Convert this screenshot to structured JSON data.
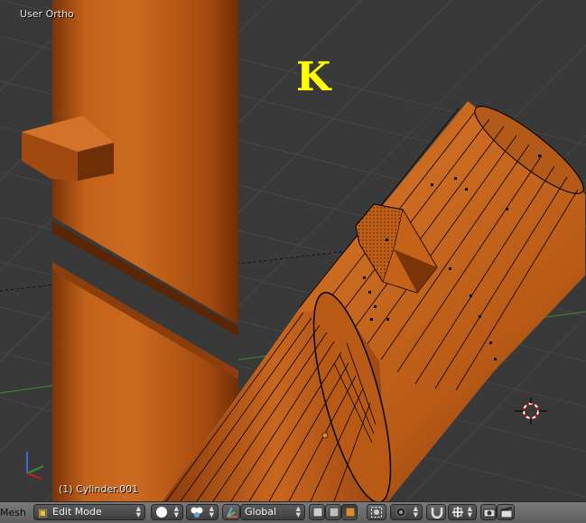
{
  "viewport": {
    "view_label": "User Ortho",
    "object_label": "(1) Cylinder.001",
    "key_indicator": "K",
    "icons": [
      "3d-cursor-icon",
      "axis-gizmo-icon"
    ]
  },
  "header": {
    "editor_type_label": "Mesh",
    "mode": {
      "value": "Edit Mode",
      "icon": "edit-mode-icon"
    },
    "viewport_shading_icon": "solid-sphere-icon",
    "pivot_icon": "pivot-point-icon",
    "transform_orientation": {
      "value": "Global",
      "icon": "manipulator-icon"
    },
    "select_mode_icons": [
      "vertex-select-icon",
      "edge-select-icon",
      "face-select-icon"
    ],
    "limit_selection_icon": "limit-selection-icon",
    "proportional_icon": "proportional-edit-icon",
    "snap_icons": [
      "magnet-icon",
      "snap-element-icon"
    ],
    "render_icons": [
      "camera-icon",
      "clapper-icon"
    ]
  },
  "colors": {
    "viewport_bg": "#393939",
    "grid": "#444444",
    "wood": "#c2621b",
    "key_indicator": "#ffff00",
    "x_axis": "#8b2020",
    "y_axis": "#3c8c2e"
  }
}
